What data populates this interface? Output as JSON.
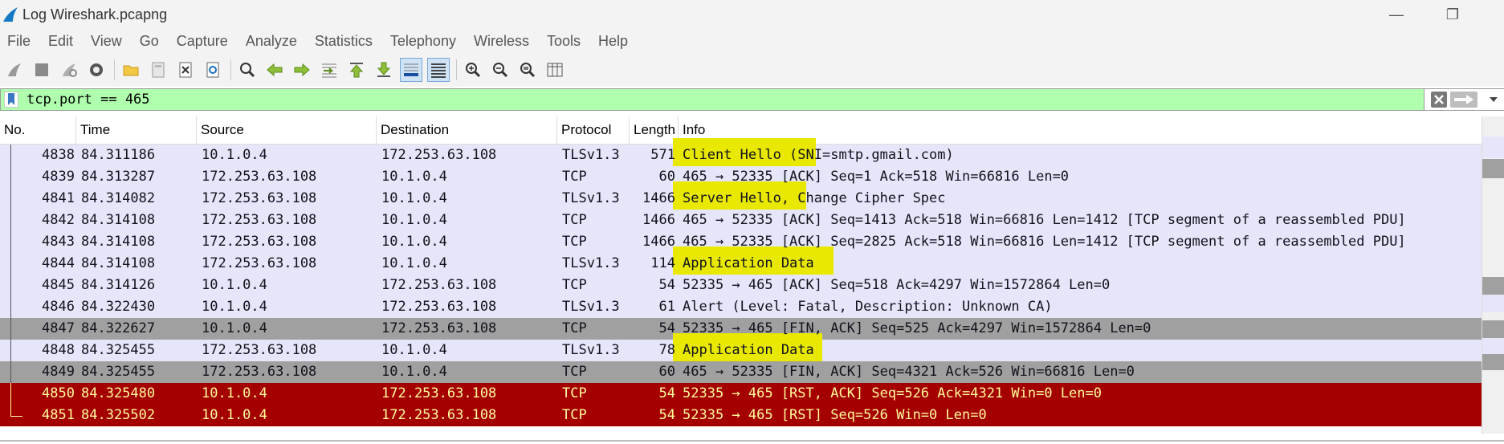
{
  "window": {
    "title": "Log Wireshark.pcapng",
    "minimize": "—",
    "restore": "❐"
  },
  "menu": [
    "File",
    "Edit",
    "View",
    "Go",
    "Capture",
    "Analyze",
    "Statistics",
    "Telephony",
    "Wireless",
    "Tools",
    "Help"
  ],
  "filter": {
    "value": "tcp.port == 465",
    "color": "#afffaf"
  },
  "columns": {
    "no": "No.",
    "time": "Time",
    "source": "Source",
    "destination": "Destination",
    "protocol": "Protocol",
    "length": "Length",
    "info": "Info"
  },
  "colors": {
    "normal": "#e6e6fa",
    "fin": "#a0a0a0",
    "rst": "#a40000",
    "rst_text": "#fffc9c",
    "highlight": "#e8e800"
  },
  "packets": [
    {
      "no": "4838",
      "time": "84.311186",
      "src": "10.1.0.4",
      "dst": "172.253.63.108",
      "proto": "TLSv1.3",
      "len": "571",
      "info": "Client Hello (SNI=smtp.gmail.com)",
      "style": "normal"
    },
    {
      "no": "4839",
      "time": "84.313287",
      "src": "172.253.63.108",
      "dst": "10.1.0.4",
      "proto": "TCP",
      "len": "60",
      "info": "465 → 52335 [ACK] Seq=1 Ack=518 Win=66816 Len=0",
      "style": "normal"
    },
    {
      "no": "4841",
      "time": "84.314082",
      "src": "172.253.63.108",
      "dst": "10.1.0.4",
      "proto": "TLSv1.3",
      "len": "1466",
      "info": "Server Hello, Change Cipher Spec",
      "style": "normal"
    },
    {
      "no": "4842",
      "time": "84.314108",
      "src": "172.253.63.108",
      "dst": "10.1.0.4",
      "proto": "TCP",
      "len": "1466",
      "info": "465 → 52335 [ACK] Seq=1413 Ack=518 Win=66816 Len=1412 [TCP segment of a reassembled PDU]",
      "style": "normal"
    },
    {
      "no": "4843",
      "time": "84.314108",
      "src": "172.253.63.108",
      "dst": "10.1.0.4",
      "proto": "TCP",
      "len": "1466",
      "info": "465 → 52335 [ACK] Seq=2825 Ack=518 Win=66816 Len=1412 [TCP segment of a reassembled PDU]",
      "style": "normal"
    },
    {
      "no": "4844",
      "time": "84.314108",
      "src": "172.253.63.108",
      "dst": "10.1.0.4",
      "proto": "TLSv1.3",
      "len": "114",
      "info": "Application Data",
      "style": "normal"
    },
    {
      "no": "4845",
      "time": "84.314126",
      "src": "10.1.0.4",
      "dst": "172.253.63.108",
      "proto": "TCP",
      "len": "54",
      "info": "52335 → 465 [ACK] Seq=518 Ack=4297 Win=1572864 Len=0",
      "style": "normal"
    },
    {
      "no": "4846",
      "time": "84.322430",
      "src": "10.1.0.4",
      "dst": "172.253.63.108",
      "proto": "TLSv1.3",
      "len": "61",
      "info": "Alert (Level: Fatal, Description: Unknown CA)",
      "style": "normal"
    },
    {
      "no": "4847",
      "time": "84.322627",
      "src": "10.1.0.4",
      "dst": "172.253.63.108",
      "proto": "TCP",
      "len": "54",
      "info": "52335 → 465 [FIN, ACK] Seq=525 Ack=4297 Win=1572864 Len=0",
      "style": "fin"
    },
    {
      "no": "4848",
      "time": "84.325455",
      "src": "172.253.63.108",
      "dst": "10.1.0.4",
      "proto": "TLSv1.3",
      "len": "78",
      "info": "Application Data",
      "style": "normal"
    },
    {
      "no": "4849",
      "time": "84.325455",
      "src": "172.253.63.108",
      "dst": "10.1.0.4",
      "proto": "TCP",
      "len": "60",
      "info": "465 → 52335 [FIN, ACK] Seq=4321 Ack=526 Win=66816 Len=0",
      "style": "fin"
    },
    {
      "no": "4850",
      "time": "84.325480",
      "src": "10.1.0.4",
      "dst": "172.253.63.108",
      "proto": "TCP",
      "len": "54",
      "info": "52335 → 465 [RST, ACK] Seq=526 Ack=4321 Win=0 Len=0",
      "style": "rst"
    },
    {
      "no": "4851",
      "time": "84.325502",
      "src": "10.1.0.4",
      "dst": "172.253.63.108",
      "proto": "TCP",
      "len": "54",
      "info": "52335 → 465 [RST] Seq=526 Win=0 Len=0",
      "style": "rst"
    }
  ],
  "toolbar_icons": [
    "shark-fin-start-icon",
    "stop-icon",
    "restart-capture-icon",
    "capture-options-icon",
    "open-folder-icon",
    "save-file-icon",
    "close-file-icon",
    "reload-icon",
    "find-packet-icon",
    "go-back-icon",
    "go-forward-icon",
    "go-to-packet-icon",
    "first-packet-icon",
    "last-packet-icon",
    "auto-scroll-icon",
    "colorize-icon",
    "zoom-in-icon",
    "zoom-out-icon",
    "zoom-normal-icon",
    "resize-columns-icon"
  ]
}
